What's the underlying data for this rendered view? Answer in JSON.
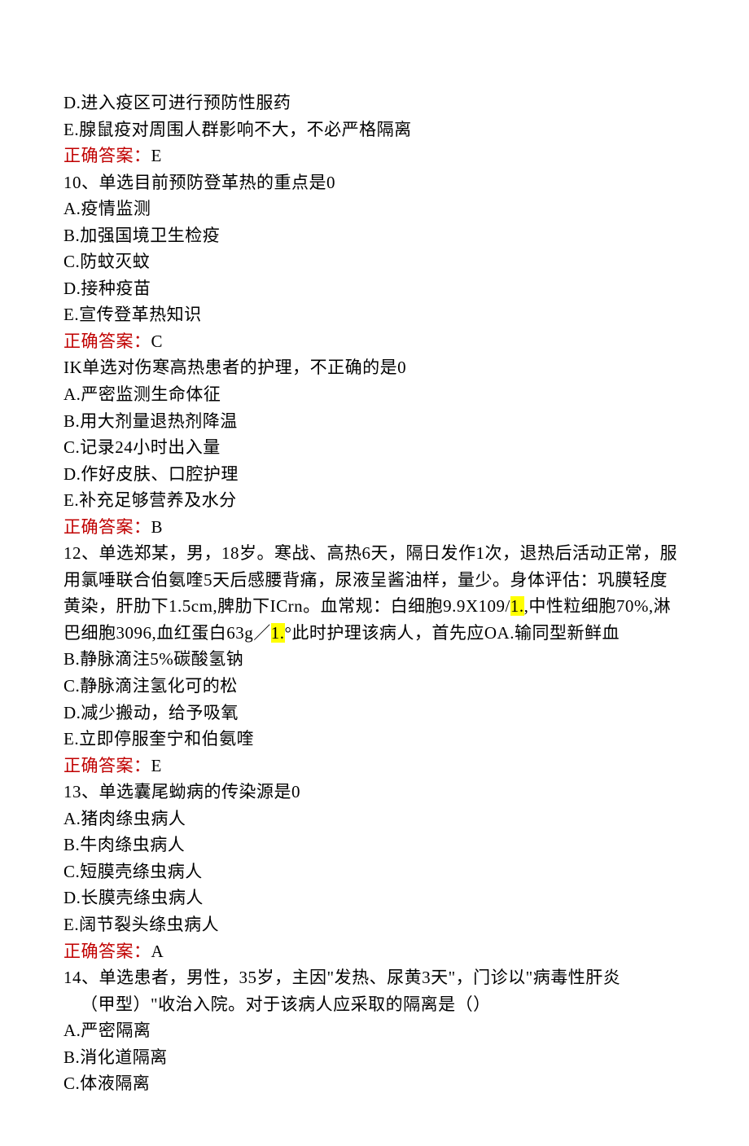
{
  "q9": {
    "optD": "D.进入疫区可进行预防性服药",
    "optE": "E.腺鼠疫对周围人群影响不大，不必严格隔离",
    "answerLabel": "正确答案：",
    "answer": "E"
  },
  "q10": {
    "stem": "10、单选目前预防登革热的重点是0",
    "optA": "A.疫情监测",
    "optB": "B.加强国境卫生检疫",
    "optC": "C.防蚊灭蚊",
    "optD": "D.接种疫苗",
    "optE": "E.宣传登革热知识",
    "answerLabel": "正确答案：",
    "answer": "C"
  },
  "q11": {
    "stem": "IK单选对伤寒高热患者的护理，不正确的是0",
    "optA": "A.严密监测生命体征",
    "optB": "B.用大剂量退热剂降温",
    "optC": "C.记录24小时出入量",
    "optD": "D.作好皮肤、口腔护理",
    "optE": "E.补充足够营养及水分",
    "answerLabel": "正确答案：",
    "answer": "B"
  },
  "q12": {
    "stemL1": "12、单选郑某，男，18岁。寒战、高热6天，隔日发作1次，退热后活动正常，服",
    "stemL2": "用氯唾联合伯氨喹5天后感腰背痛，尿液呈酱油样，量少。身体评估：巩膜轻度",
    "stemL3a": "黄染，肝肋下1.5cm,脾肋下ICrn。血常规：白细胞9.9X109/",
    "stemL3hl": "1.",
    "stemL3b": ",中性粒细胞70%,淋",
    "stemL4a": "巴细胞3096,血红蛋白63g／",
    "stemL4hl": "1.",
    "stemL4b": "°此时护理该病人，首先应OA.输同型新鲜血",
    "optB": "B.静脉滴注5%碳酸氢钠",
    "optC": "C.静脉滴注氢化可的松",
    "optD": "D.减少搬动，给予吸氧",
    "optE": "E.立即停服奎宁和伯氨喹",
    "answerLabel": "正确答案：",
    "answer": "E"
  },
  "q13": {
    "stem": "13、单选囊尾蚴病的传染源是0",
    "optA": "A.猪肉绦虫病人",
    "optB": "B.牛肉绦虫病人",
    "optC": "C.短膜壳绦虫病人",
    "optD": "D.长膜壳绦虫病人",
    "optE": "E.阔节裂头绦虫病人",
    "answerLabel": "正确答案：",
    "answer": "A"
  },
  "q14": {
    "stemL1": "14、单选患者，男性，35岁，主因\"发热、尿黄3天\"，门诊以\"病毒性肝炎",
    "stemL2": "（甲型）\"收治入院。对于该病人应采取的隔离是（）",
    "optA": "A.严密隔离",
    "optB": "B.消化道隔离",
    "optC": "C.体液隔离"
  }
}
